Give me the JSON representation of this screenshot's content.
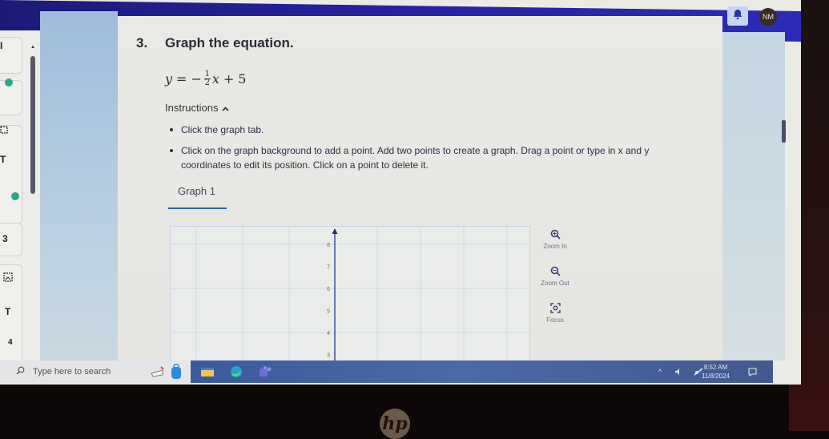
{
  "header": {
    "notifications_icon": "bell-icon",
    "user_initials": "NM"
  },
  "sidebar": {
    "items": [
      {
        "type": "text",
        "label": "I"
      },
      {
        "type": "status",
        "icon": "dot-icon",
        "color": "#2aa58a"
      },
      {
        "type": "icon",
        "icon": "image-icon"
      },
      {
        "type": "icon",
        "icon": "text-icon",
        "label": "T"
      },
      {
        "type": "status",
        "icon": "dot-icon",
        "color": "#2aa58a"
      },
      {
        "type": "number",
        "label": "3"
      },
      {
        "type": "icon",
        "icon": "image-icon"
      },
      {
        "type": "icon",
        "icon": "text-icon",
        "label": "T"
      },
      {
        "type": "number",
        "label": "4"
      }
    ]
  },
  "question": {
    "number": "3.",
    "title": "Graph the equation.",
    "equation": {
      "lhs": "y",
      "equals": "=",
      "sign": "−",
      "numerator": "1",
      "denominator": "2",
      "variable": "x",
      "plus": "+",
      "constant": "5"
    },
    "instructions_label": "Instructions",
    "instructions": [
      "Click the graph tab.",
      "Click on the graph background to add a point. Add two points to create a graph. Drag a point or type in x and y coordinates to edit its position. Click on a point to delete it."
    ]
  },
  "tabs": [
    {
      "label": "Graph 1",
      "active": true
    }
  ],
  "graph": {
    "y_ticks": [
      "8",
      "7",
      "6",
      "5",
      "4",
      "3"
    ],
    "y_visible_range": [
      3,
      8.5
    ],
    "tools": [
      {
        "label": "Zoom In",
        "icon": "zoom-in-icon"
      },
      {
        "label": "Zoom Out",
        "icon": "zoom-out-icon"
      },
      {
        "label": "Focus",
        "icon": "focus-icon"
      }
    ]
  },
  "taskbar": {
    "search_placeholder": "Type here to search",
    "apps": [
      "whiteboard-icon",
      "backpack-icon",
      "file-explorer-icon",
      "edge-icon",
      "teams-icon"
    ],
    "tray": {
      "chevron": "^",
      "time": "8:52 AM",
      "date": "11/8/2024"
    }
  },
  "bezel": {
    "logo": "hp"
  },
  "colors": {
    "accent": "#2d63b8",
    "topbar": "#2a25a8",
    "status_green": "#2aa58a",
    "axis": "#4a5a9a"
  }
}
